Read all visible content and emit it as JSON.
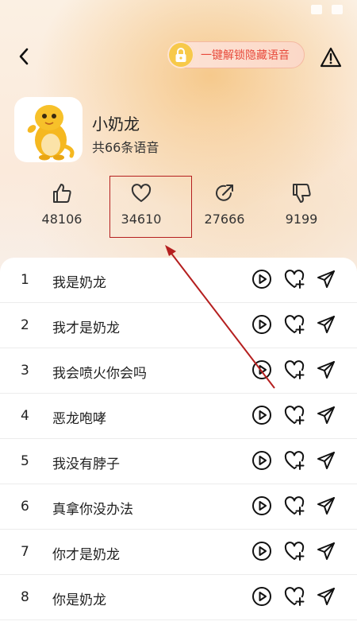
{
  "header": {
    "back_icon": "chevron-left-icon",
    "unlock_label": "一键解锁隐藏语音",
    "unlock_icon": "lock-icon",
    "report_icon": "warning-icon"
  },
  "pack": {
    "name": "小奶龙",
    "count_text": "共66条语音",
    "avatar": "yellow-dragon-avatar"
  },
  "stats": [
    {
      "icon": "thumbs-up-icon",
      "value": "48106"
    },
    {
      "icon": "heart-icon",
      "value": "34610"
    },
    {
      "icon": "share-icon",
      "value": "27666"
    },
    {
      "icon": "thumbs-down-icon",
      "value": "9199"
    }
  ],
  "colors": {
    "accent_red": "#e84a3c",
    "highlight": "#b51f1f",
    "lock_yellow": "#f7c94a"
  },
  "voices": [
    {
      "index": "1",
      "title": "我是奶龙"
    },
    {
      "index": "2",
      "title": "我才是奶龙"
    },
    {
      "index": "3",
      "title": "我会喷火你会吗"
    },
    {
      "index": "4",
      "title": "恶龙咆哮"
    },
    {
      "index": "5",
      "title": "我没有脖子"
    },
    {
      "index": "6",
      "title": "真拿你没办法"
    },
    {
      "index": "7",
      "title": "你才是奶龙"
    },
    {
      "index": "8",
      "title": "你是奶龙"
    }
  ]
}
